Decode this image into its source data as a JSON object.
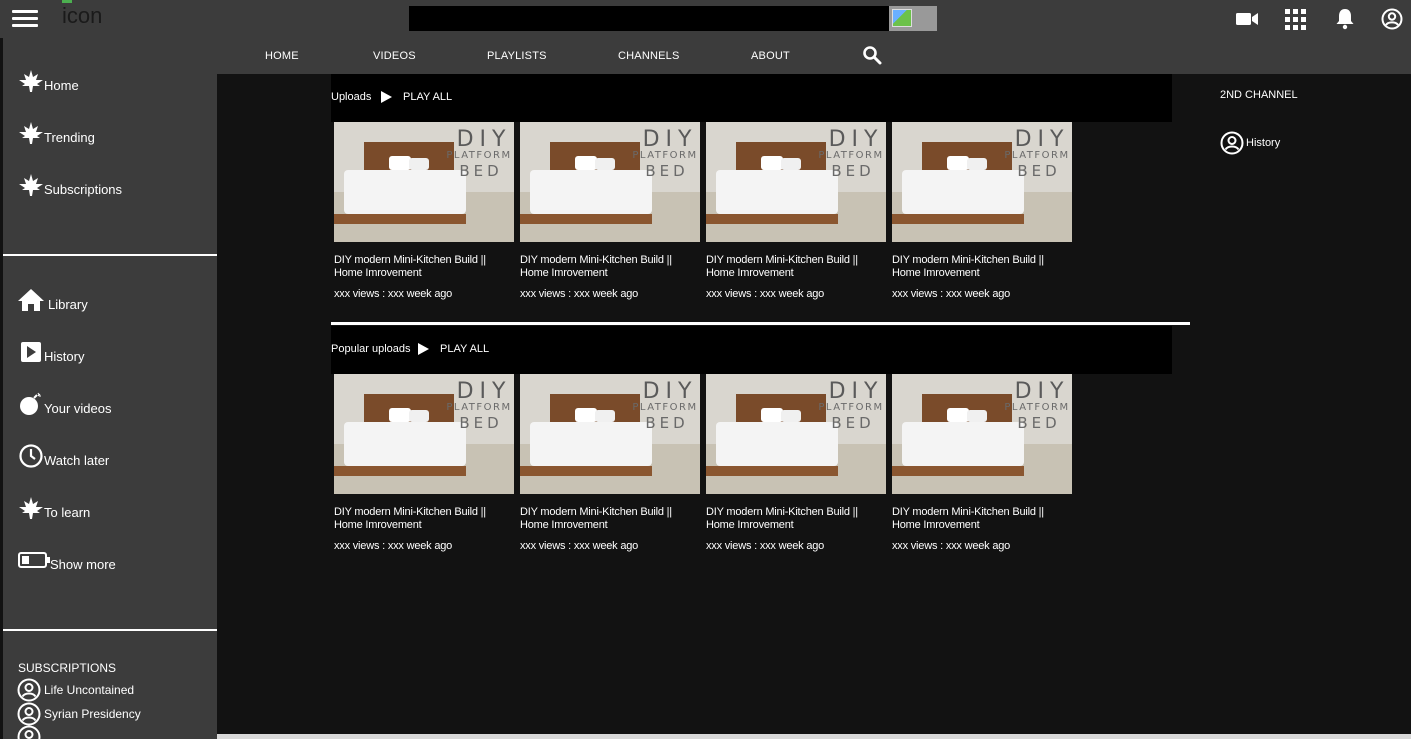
{
  "app": {
    "logo_text": "icon",
    "search": {
      "value": "",
      "placeholder": ""
    }
  },
  "topbar_icons": [
    "video-camera-icon",
    "apps-grid-icon",
    "bell-icon",
    "account-circle-icon"
  ],
  "sidebar": {
    "primary": [
      {
        "label": "Home",
        "icon": "leaf-icon"
      },
      {
        "label": "Trending",
        "icon": "leaf-icon"
      },
      {
        "label": "Subscriptions",
        "icon": "leaf-icon"
      }
    ],
    "secondary": [
      {
        "label": "Library",
        "icon": "house-icon"
      },
      {
        "label": "History",
        "icon": "play-square-icon"
      },
      {
        "label": "Your videos",
        "icon": "bomb-icon"
      },
      {
        "label": "Watch later",
        "icon": "clock-icon"
      },
      {
        "label": "To learn",
        "icon": "leaf-icon"
      },
      {
        "label": "Show more",
        "icon": "battery-icon"
      }
    ],
    "subscriptions_title": "SUBSCRIPTIONS",
    "subscriptions": [
      {
        "label": "Life Uncontained",
        "icon": "account-circle-icon"
      },
      {
        "label": "Syrian Presidency",
        "icon": "account-circle-icon"
      }
    ]
  },
  "channel_nav": {
    "tabs": [
      "HOME",
      "VIDEOS",
      "PLAYLISTS",
      "CHANNELS",
      "ABOUT"
    ],
    "search_icon": "search-icon"
  },
  "shelves": [
    {
      "title": "Uploads",
      "play_all": "PLAY ALL",
      "videos": [
        {
          "title": "DIY modern Mini-Kitchen Build || Home Imrovement",
          "meta": "xxx views : xxx week ago",
          "thumb_text": [
            "DIY",
            "PLATFORM",
            "BED"
          ]
        },
        {
          "title": "DIY modern Mini-Kitchen Build || Home Imrovement",
          "meta": "xxx views : xxx week ago",
          "thumb_text": [
            "DIY",
            "PLATFORM",
            "BED"
          ]
        },
        {
          "title": "DIY modern Mini-Kitchen Build || Home Imrovement",
          "meta": "xxx views : xxx week ago",
          "thumb_text": [
            "DIY",
            "PLATFORM",
            "BED"
          ]
        },
        {
          "title": "DIY modern Mini-Kitchen Build || Home Imrovement",
          "meta": "xxx views : xxx week ago",
          "thumb_text": [
            "DIY",
            "PLATFORM",
            "BED"
          ]
        }
      ]
    },
    {
      "title": "Popular uploads",
      "play_all": "PLAY ALL",
      "videos": [
        {
          "title": "DIY modern Mini-Kitchen Build || Home Imrovement",
          "meta": "xxx views : xxx week ago",
          "thumb_text": [
            "DIY",
            "PLATFORM",
            "BED"
          ]
        },
        {
          "title": "DIY modern Mini-Kitchen Build || Home Imrovement",
          "meta": "xxx views : xxx week ago",
          "thumb_text": [
            "DIY",
            "PLATFORM",
            "BED"
          ]
        },
        {
          "title": "DIY modern Mini-Kitchen Build || Home Imrovement",
          "meta": "xxx views : xxx week ago",
          "thumb_text": [
            "DIY",
            "PLATFORM",
            "BED"
          ]
        },
        {
          "title": "DIY modern Mini-Kitchen Build || Home Imrovement",
          "meta": "xxx views : xxx week ago",
          "thumb_text": [
            "DIY",
            "PLATFORM",
            "BED"
          ]
        }
      ]
    }
  ],
  "right_panel": {
    "title": "2ND CHANNEL",
    "items": [
      {
        "label": "History",
        "icon": "account-circle-icon"
      }
    ]
  },
  "colors": {
    "bar": "#3c3c3c",
    "background": "#121212",
    "shelf_header": "#000000",
    "text": "#ffffff"
  }
}
